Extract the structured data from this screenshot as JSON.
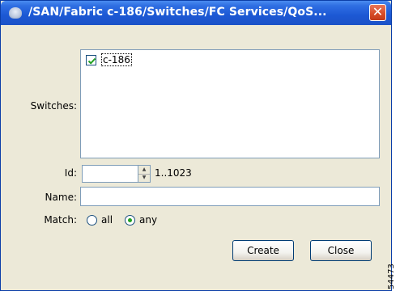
{
  "window": {
    "title": "/SAN/Fabric c-186/Switches/FC Services/QoS...",
    "close_label": "✕"
  },
  "form": {
    "switches_label": "Switches:",
    "switch_items": [
      {
        "label": "c-186",
        "checked": true
      }
    ],
    "id_label": "Id:",
    "id_value": "",
    "id_range": "1..1023",
    "name_label": "Name:",
    "name_value": "",
    "match_label": "Match:",
    "match_options": [
      {
        "label": "all",
        "selected": false
      },
      {
        "label": "any",
        "selected": true
      }
    ]
  },
  "buttons": {
    "create_label": "Create",
    "close_label": "Close"
  },
  "figure_id": "54473",
  "colors": {
    "titlebar": "#1c58d4",
    "window_bg": "#ece9d8",
    "close_button": "#d64a26",
    "input_border": "#7f9db9",
    "radio_selected": "#21a121",
    "checkmark": "#21a121"
  },
  "icons": {
    "title_icon": "app-globe-icon",
    "close_icon": "close-icon",
    "spinner_up": "chevron-up-icon",
    "spinner_down": "chevron-down-icon",
    "checkbox": "checkmark-icon"
  }
}
